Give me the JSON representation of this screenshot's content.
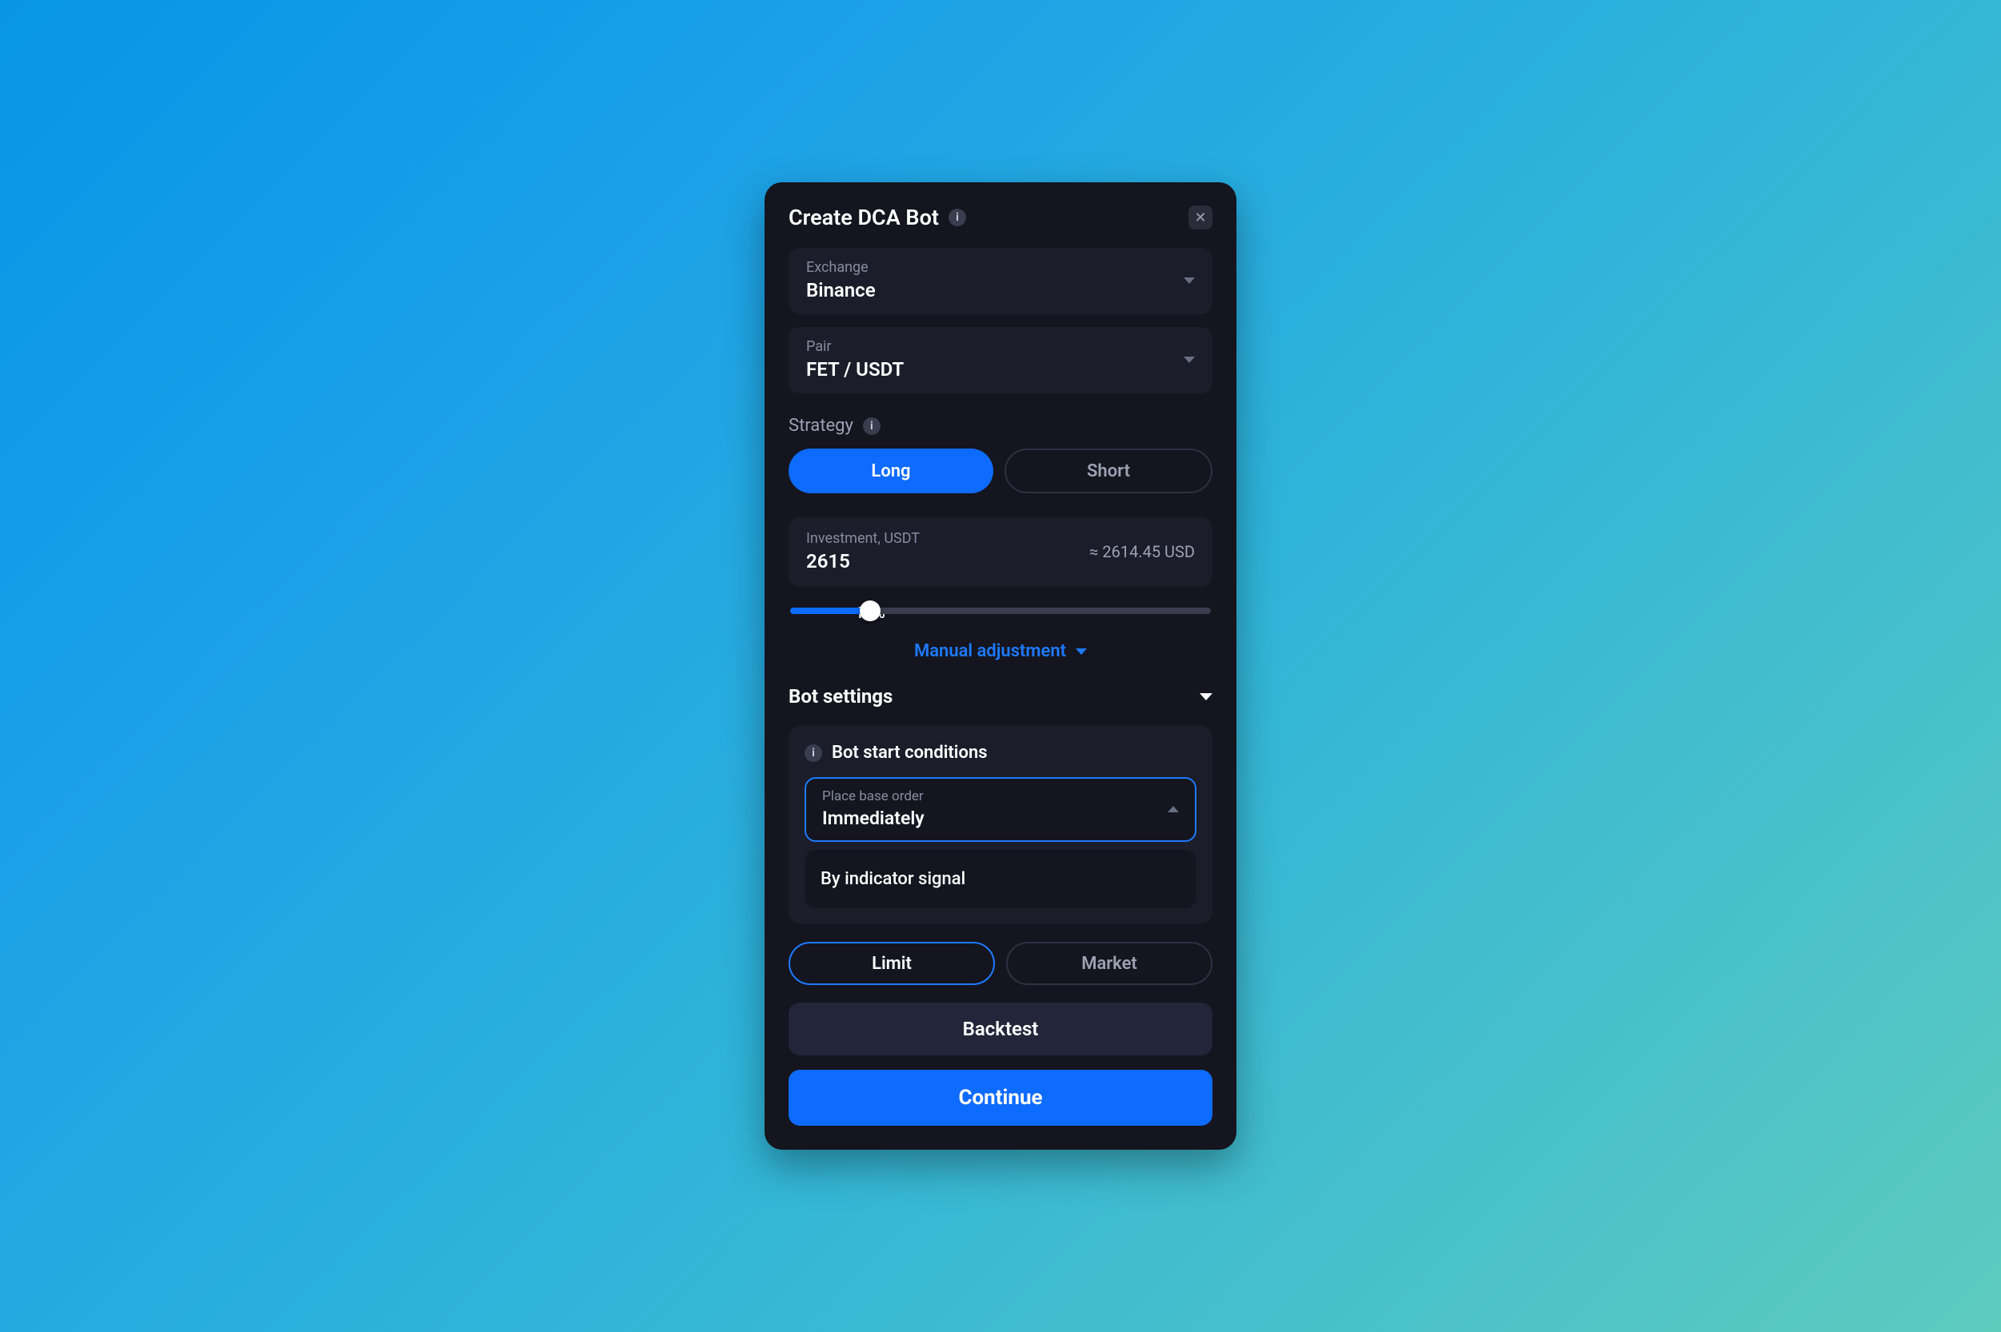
{
  "header": {
    "title": "Create DCA Bot"
  },
  "exchange": {
    "label": "Exchange",
    "value": "Binance"
  },
  "pair": {
    "label": "Pair",
    "value": "FET / USDT"
  },
  "strategy": {
    "label": "Strategy",
    "options": {
      "long": "Long",
      "short": "Short"
    }
  },
  "investment": {
    "label": "Investment, USDT",
    "value": "2615",
    "approx": "≈ 2614.45 USD",
    "percent": "19%",
    "percent_num": 19
  },
  "manual_adjustment": "Manual adjustment",
  "bot_settings": {
    "title": "Bot settings",
    "start_conditions": {
      "title": "Bot start conditions",
      "dropdown_label": "Place base order",
      "selected": "Immediately",
      "option_alt": "By indicator signal"
    },
    "order_type": {
      "limit": "Limit",
      "market": "Market"
    }
  },
  "actions": {
    "backtest": "Backtest",
    "continue": "Continue"
  }
}
